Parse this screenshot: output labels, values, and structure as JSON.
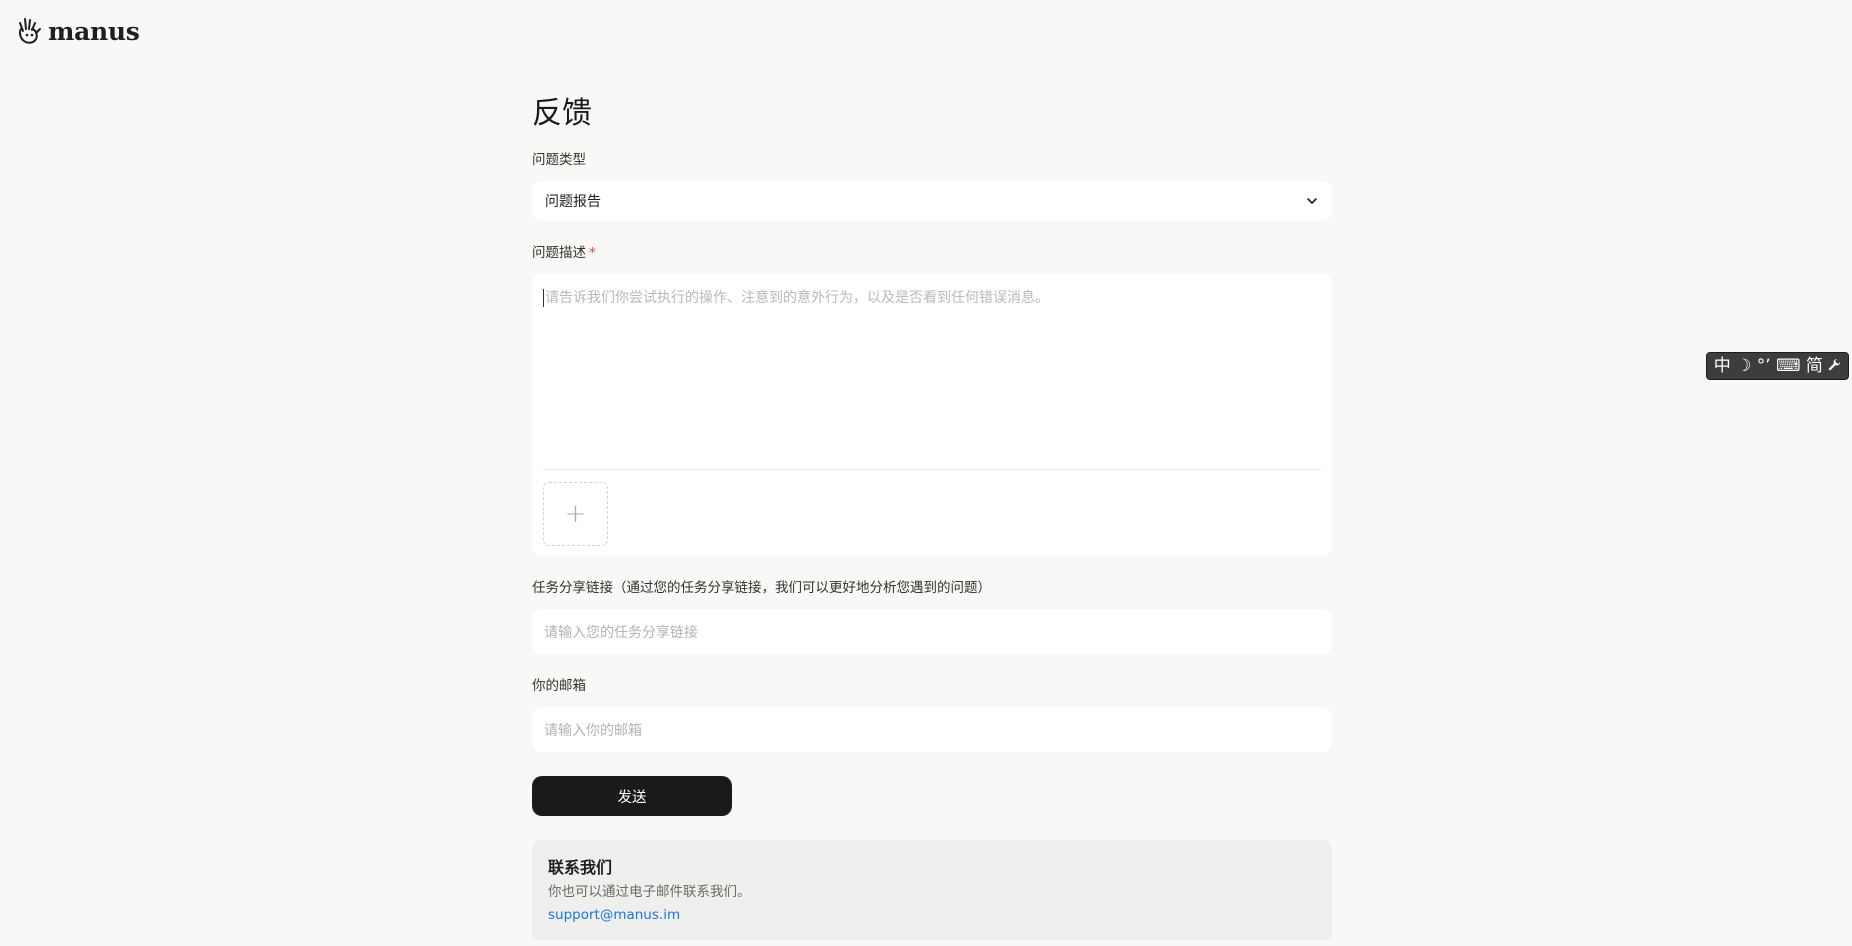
{
  "brand": {
    "name": "manus"
  },
  "ime": {
    "items": [
      "中",
      "☽",
      "°ʼ",
      "⌨",
      "简",
      "🔧"
    ]
  },
  "page": {
    "title": "反馈"
  },
  "form": {
    "issue_type": {
      "label": "问题类型",
      "selected": "问题报告"
    },
    "description": {
      "label": "问题描述",
      "required_mark": "*",
      "placeholder": "请告诉我们你尝试执行的操作、注意到的意外行为，以及是否看到任何错误消息。",
      "upload_symbol": "+"
    },
    "share_link": {
      "label": "任务分享链接（通过您的任务分享链接，我们可以更好地分析您遇到的问题）",
      "placeholder": "请输入您的任务分享链接"
    },
    "email": {
      "label": "你的邮箱",
      "placeholder": "请输入你的邮箱"
    },
    "submit_label": "发送"
  },
  "contact": {
    "title": "联系我们",
    "description": "你也可以通过电子邮件联系我们。",
    "email": "support@manus.im"
  }
}
